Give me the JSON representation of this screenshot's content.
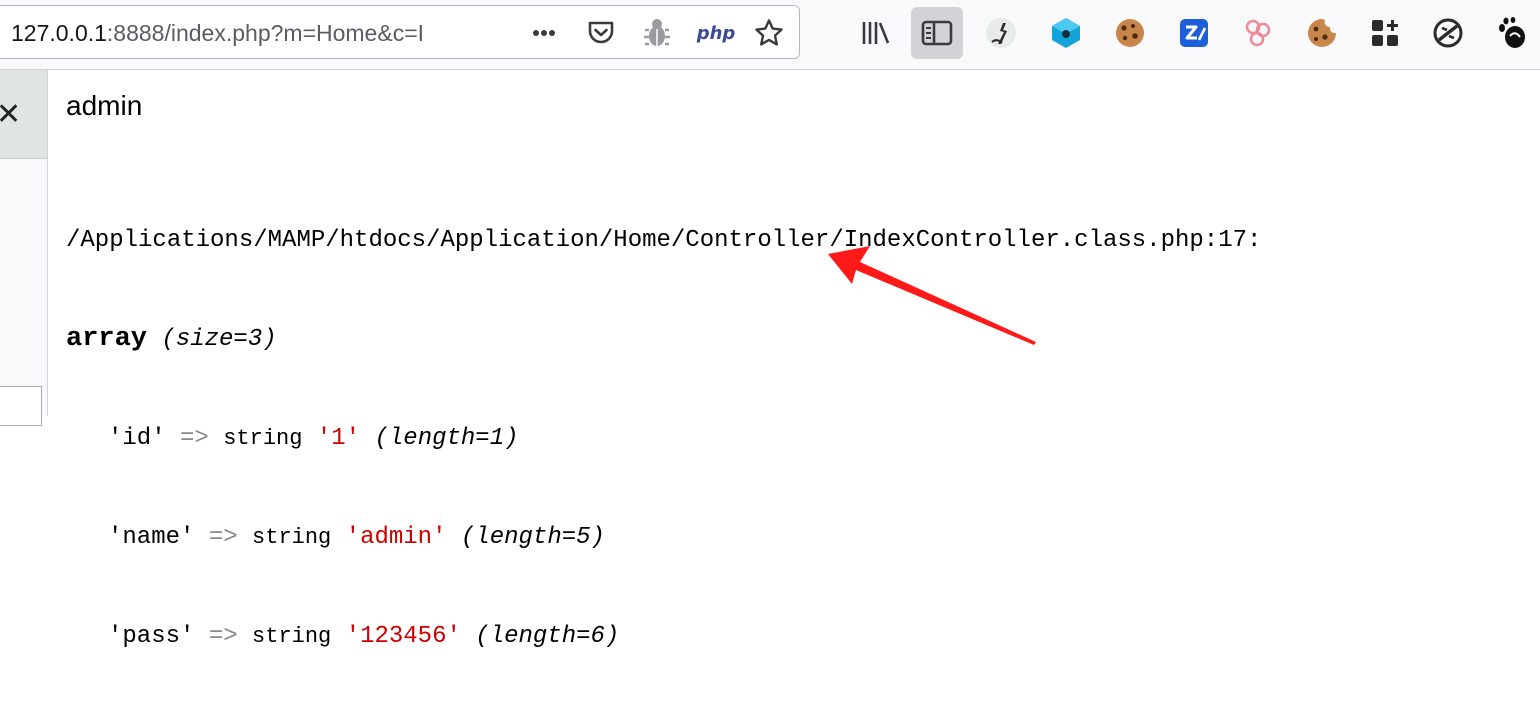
{
  "browser": {
    "url_host": "127.0.0.1",
    "url_rest": ":8888/index.php?m=Home&c=I",
    "php_label": "php"
  },
  "page": {
    "echo_text": "admin",
    "dump": {
      "path": "/Applications/MAMP/htdocs/Application/Home/Controller/IndexController.class.php:17:",
      "array_kw": "array",
      "array_size": "(size=3)",
      "arrow_op": "=>",
      "entries": [
        {
          "key": "'id'",
          "type": "string",
          "value": "'1'",
          "length": "(length=1)"
        },
        {
          "key": "'name'",
          "type": "string",
          "value": "'admin'",
          "length": "(length=5)"
        },
        {
          "key": "'pass'",
          "type": "string",
          "value": "'123456'",
          "length": "(length=6)"
        }
      ]
    }
  },
  "colors": {
    "string_value": "#cc0000",
    "operator": "#888a85",
    "annotation_arrow": "#ff0000"
  }
}
